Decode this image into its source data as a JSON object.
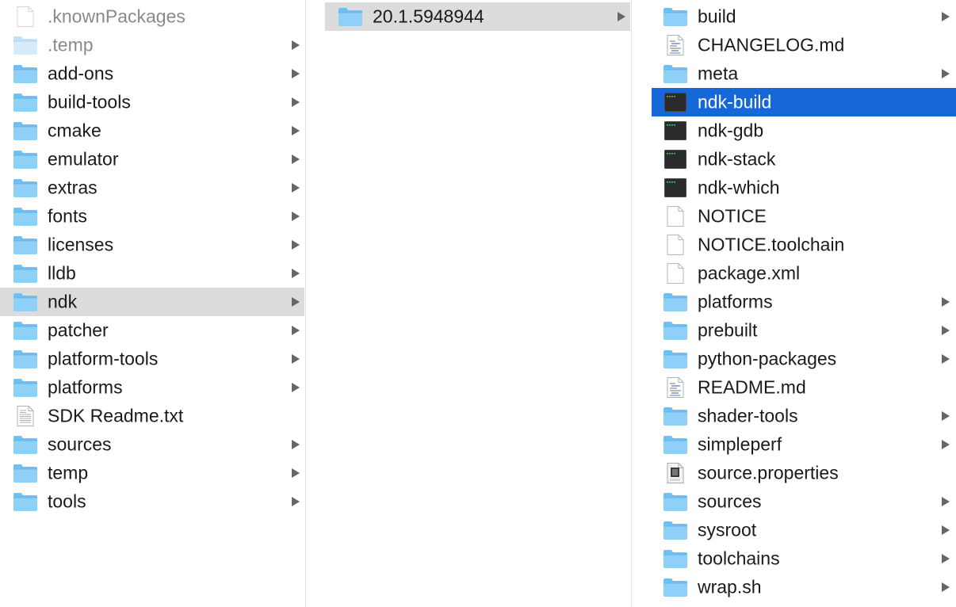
{
  "columns": [
    {
      "items": [
        {
          "label": ".knownPackages",
          "icon": "blank-file-icon",
          "has_children": false,
          "dim": true
        },
        {
          "label": ".temp",
          "icon": "folder-icon",
          "has_children": true,
          "dim": true
        },
        {
          "label": "add-ons",
          "icon": "folder-icon",
          "has_children": true
        },
        {
          "label": "build-tools",
          "icon": "folder-icon",
          "has_children": true
        },
        {
          "label": "cmake",
          "icon": "folder-icon",
          "has_children": true
        },
        {
          "label": "emulator",
          "icon": "folder-icon",
          "has_children": true
        },
        {
          "label": "extras",
          "icon": "folder-icon",
          "has_children": true
        },
        {
          "label": "fonts",
          "icon": "folder-icon",
          "has_children": true
        },
        {
          "label": "licenses",
          "icon": "folder-icon",
          "has_children": true
        },
        {
          "label": "lldb",
          "icon": "folder-icon",
          "has_children": true
        },
        {
          "label": "ndk",
          "icon": "folder-icon",
          "has_children": true,
          "selected": "gray"
        },
        {
          "label": "patcher",
          "icon": "folder-icon",
          "has_children": true
        },
        {
          "label": "platform-tools",
          "icon": "folder-icon",
          "has_children": true
        },
        {
          "label": "platforms",
          "icon": "folder-icon",
          "has_children": true
        },
        {
          "label": "SDK Readme.txt",
          "icon": "text-file-icon",
          "has_children": false
        },
        {
          "label": "sources",
          "icon": "folder-icon",
          "has_children": true
        },
        {
          "label": "temp",
          "icon": "folder-icon",
          "has_children": true
        },
        {
          "label": "tools",
          "icon": "folder-icon",
          "has_children": true
        }
      ]
    },
    {
      "items": [
        {
          "label": "20.1.5948944",
          "icon": "folder-icon",
          "has_children": true,
          "selected": "gray"
        }
      ]
    },
    {
      "items": [
        {
          "label": "build",
          "icon": "folder-icon",
          "has_children": true
        },
        {
          "label": "CHANGELOG.md",
          "icon": "markdown-file-icon",
          "has_children": false
        },
        {
          "label": "meta",
          "icon": "folder-icon",
          "has_children": true
        },
        {
          "label": "ndk-build",
          "icon": "terminal-exec-icon",
          "has_children": false,
          "selected": "blue"
        },
        {
          "label": "ndk-gdb",
          "icon": "terminal-exec-icon",
          "has_children": false
        },
        {
          "label": "ndk-stack",
          "icon": "terminal-exec-icon",
          "has_children": false
        },
        {
          "label": "ndk-which",
          "icon": "terminal-exec-icon",
          "has_children": false
        },
        {
          "label": "NOTICE",
          "icon": "blank-file-icon",
          "has_children": false
        },
        {
          "label": "NOTICE.toolchain",
          "icon": "blank-file-icon",
          "has_children": false
        },
        {
          "label": "package.xml",
          "icon": "blank-file-icon",
          "has_children": false
        },
        {
          "label": "platforms",
          "icon": "folder-icon",
          "has_children": true
        },
        {
          "label": "prebuilt",
          "icon": "folder-icon",
          "has_children": true
        },
        {
          "label": "python-packages",
          "icon": "folder-icon",
          "has_children": true
        },
        {
          "label": "README.md",
          "icon": "markdown-file-icon",
          "has_children": false
        },
        {
          "label": "shader-tools",
          "icon": "folder-icon",
          "has_children": true
        },
        {
          "label": "simpleperf",
          "icon": "folder-icon",
          "has_children": true
        },
        {
          "label": "source.properties",
          "icon": "java-file-icon",
          "has_children": false
        },
        {
          "label": "sources",
          "icon": "folder-icon",
          "has_children": true
        },
        {
          "label": "sysroot",
          "icon": "folder-icon",
          "has_children": true
        },
        {
          "label": "toolchains",
          "icon": "folder-icon",
          "has_children": true
        },
        {
          "label": "wrap.sh",
          "icon": "folder-icon",
          "has_children": true
        }
      ]
    }
  ],
  "colors": {
    "selection_blue": "#1668d8",
    "selection_gray": "#dcdcdc",
    "folder_blue": "#5bb4ef"
  }
}
